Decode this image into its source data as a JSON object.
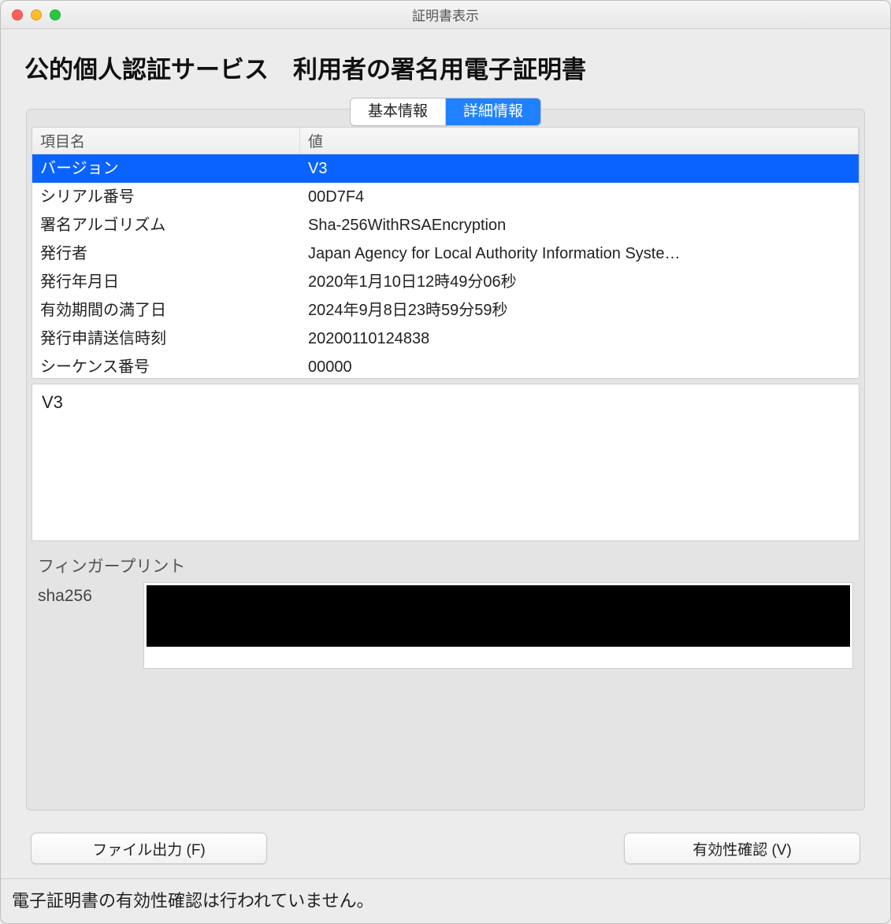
{
  "window": {
    "title": "証明書表示"
  },
  "page": {
    "title": "公的個人認証サービス　利用者の署名用電子証明書"
  },
  "tabs": {
    "basic": "基本情報",
    "detail": "詳細情報",
    "active": "detail"
  },
  "table": {
    "headers": {
      "key": "項目名",
      "value": "値"
    },
    "rows": [
      {
        "key": "バージョン",
        "value": "V3",
        "selected": true
      },
      {
        "key": "シリアル番号",
        "value": "00D7F4"
      },
      {
        "key": "署名アルゴリズム",
        "value": "Sha-256WithRSAEncryption"
      },
      {
        "key": "発行者",
        "value": "Japan Agency for Local Authority Information Syste…"
      },
      {
        "key": "発行年月日",
        "value": "2020年1月10日12時49分06秒"
      },
      {
        "key": "有効期間の満了日",
        "value": "2024年9月8日23時59分59秒"
      },
      {
        "key": "発行申請送信時刻",
        "value": "20200110124838"
      },
      {
        "key": "シーケンス番号",
        "value": "00000"
      }
    ]
  },
  "detail": {
    "value": "V3"
  },
  "fingerprint": {
    "title": "フィンガープリント",
    "label": "sha256",
    "value_redacted": true
  },
  "buttons": {
    "export": "ファイル出力 (F)",
    "verify": "有効性確認 (V)"
  },
  "status": "電子証明書の有効性確認は行われていません。"
}
